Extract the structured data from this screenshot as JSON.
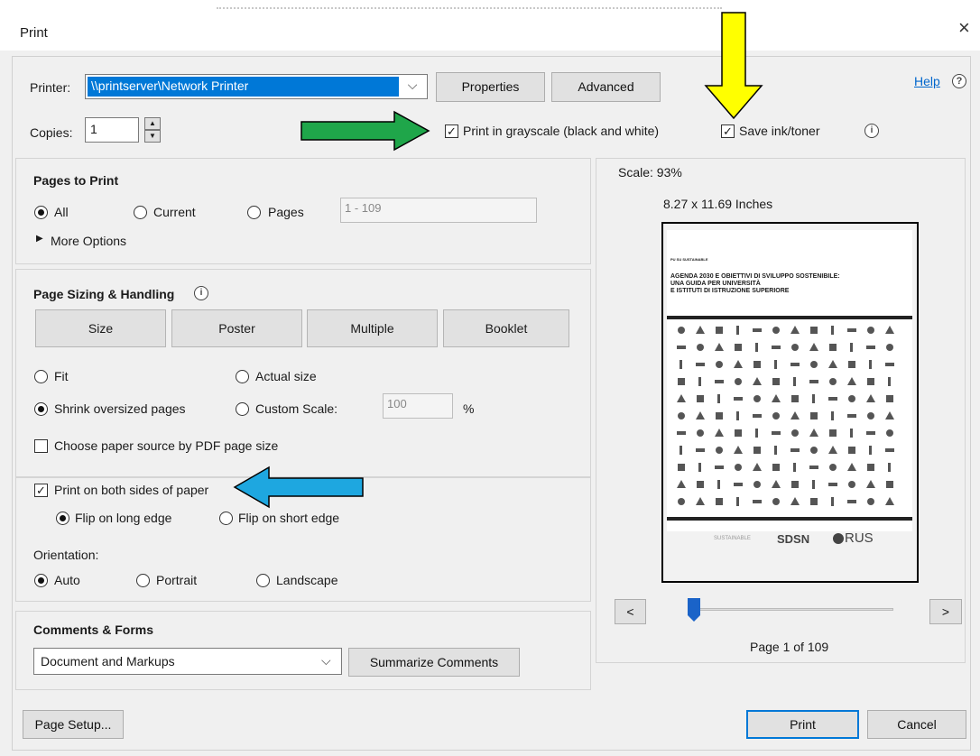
{
  "window": {
    "title": "Print",
    "close": "×"
  },
  "printer": {
    "label": "Printer:",
    "value": "\\\\printserver\\Network Printer",
    "properties": "Properties",
    "advanced": "Advanced",
    "help": "Help",
    "help_glyph": "?"
  },
  "copies": {
    "label": "Copies:",
    "value": "1"
  },
  "grayscale": {
    "label": "Print in grayscale (black and white)",
    "checked": true
  },
  "save_ink": {
    "label": "Save ink/toner",
    "checked": true
  },
  "pages": {
    "heading": "Pages to Print",
    "all": "All",
    "current": "Current",
    "pages": "Pages",
    "range_placeholder": "1 - 109",
    "more": "More Options",
    "selected": "All"
  },
  "sizing": {
    "heading": "Page Sizing & Handling",
    "size": "Size",
    "poster": "Poster",
    "multiple": "Multiple",
    "booklet": "Booklet",
    "fit": "Fit",
    "actual": "Actual size",
    "shrink": "Shrink oversized pages",
    "custom": "Custom Scale:",
    "custom_value": "100",
    "percent": "%",
    "paper_source": "Choose paper source by PDF page size",
    "selected": "Shrink oversized pages"
  },
  "duplex": {
    "label": "Print on both sides of paper",
    "checked": true,
    "long": "Flip on long edge",
    "short": "Flip on short edge",
    "selected": "Flip on long edge"
  },
  "orientation": {
    "heading": "Orientation:",
    "auto": "Auto",
    "portrait": "Portrait",
    "landscape": "Landscape",
    "selected": "Auto"
  },
  "comments": {
    "heading": "Comments & Forms",
    "value": "Document and Markups",
    "summarize": "Summarize Comments"
  },
  "preview": {
    "scale": "Scale: 93%",
    "dims": "8.27 x 11.69 Inches",
    "doc_small": "PU SU SUSTAINABLE",
    "doc_title_1": "AGENDA 2030 E OBIETTIVI DI SVILUPPO SOSTENIBILE:",
    "doc_title_2": "UNA GUIDA PER UNIVERSITÀ",
    "doc_title_3": "E ISTITUTI DI ISTRUZIONE SUPERIORE",
    "logo1": "SUSTAINABLE",
    "logo2": "SDSN",
    "logo3": "RUS",
    "prev": "<",
    "next": ">",
    "page_label": "Page 1 of 109",
    "page_current": 1,
    "page_total": 109
  },
  "footer": {
    "page_setup": "Page Setup...",
    "print": "Print",
    "cancel": "Cancel"
  },
  "colors": {
    "accent": "#0078d7",
    "arrow_green": "#1fa64a",
    "arrow_yellow": "#ffff00",
    "arrow_blue": "#1ea7e0"
  },
  "icons": [
    "close-icon",
    "dropdown-chevron-icon",
    "help-icon",
    "info-icon",
    "spin-up-icon",
    "spin-down-icon",
    "triangle-right-icon",
    "arrow-right-icon",
    "arrow-down-icon",
    "arrow-left-icon"
  ]
}
